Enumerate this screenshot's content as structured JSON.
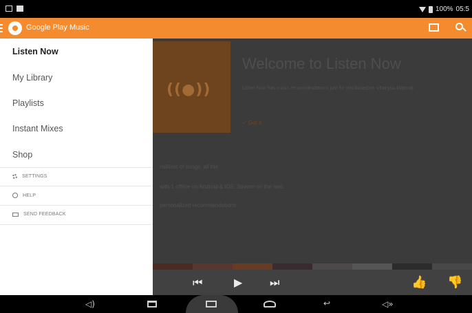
{
  "status_bar": {
    "battery_text": "100%",
    "time": "05:5"
  },
  "app_bar": {
    "title": "Google Play Music",
    "icons": [
      "menu-icon",
      "headphones-logo-icon",
      "cast-icon",
      "search-icon"
    ]
  },
  "drawer": {
    "items": [
      {
        "label": "Listen Now",
        "active": true
      },
      {
        "label": "My Library",
        "active": false
      },
      {
        "label": "Playlists",
        "active": false
      },
      {
        "label": "Instant Mixes",
        "active": false
      },
      {
        "label": "Shop",
        "active": false
      }
    ],
    "secondary": [
      {
        "label": "SETTINGS",
        "icon": "gear-icon"
      },
      {
        "label": "HELP",
        "icon": "help-icon"
      },
      {
        "label": "SEND FEEDBACK",
        "icon": "feedback-icon"
      }
    ]
  },
  "content": {
    "welcome_title": "Welcome to Listen Now",
    "welcome_desc": "Listen Now has music recommendations just for you based on what you listen to.",
    "got_it": "✓ Got it",
    "card_lines": [
      "millions of songs, all the",
      "with 1 offline on Android & iOS. Stream on the web.",
      "personalized recommendations."
    ],
    "strip_colors": [
      "#4a2a22",
      "#5a3630",
      "#6a3b23",
      "#3a2b32",
      "#4e4848",
      "#555555",
      "#2c2c2c",
      "#484848"
    ]
  },
  "player": {
    "icons": [
      "previous-icon",
      "play-icon",
      "next-icon",
      "thumbs-up-icon",
      "thumbs-down-icon"
    ]
  },
  "nav_bar": {
    "icons": [
      "volume-down-icon",
      "recent-apps-icon",
      "screenshot-icon",
      "home-icon",
      "back-icon",
      "volume-up-icon"
    ]
  },
  "colors": {
    "accent": "#f48b2e",
    "dim_overlay": "#3b3b3b",
    "drawer_bg": "#ffffff"
  }
}
